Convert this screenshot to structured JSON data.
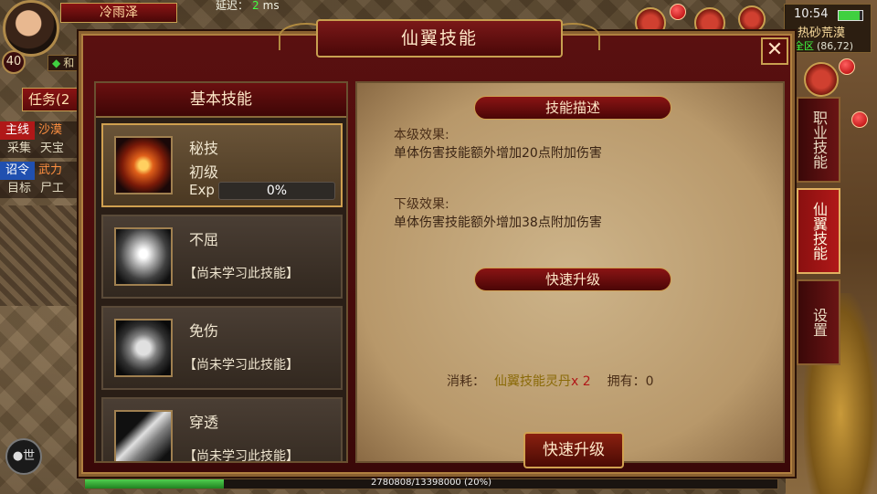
{
  "hud": {
    "player_name": "冷雨泽",
    "level": "40",
    "ping_label": "延迟：",
    "ping_value": "2",
    "ping_unit": "ms",
    "small_label": "和",
    "clock": "10:54",
    "zone_name": "热砂荒漠",
    "zone_scope": "全区",
    "zone_coords": "(86,72)",
    "battery_level": 0.9
  },
  "tasks": {
    "tab_label": "任务(2",
    "rows": [
      {
        "tag": "主线",
        "tag_color": "red",
        "text": "沙漠"
      },
      {
        "sub_a": "采集",
        "sub_b": "天宝"
      },
      {
        "tag": "诏令",
        "tag_color": "blue",
        "text": "武力"
      },
      {
        "sub_a": "目标",
        "sub_b": "尸工"
      }
    ]
  },
  "voice": {
    "label": "世"
  },
  "modal": {
    "title": "仙翼技能",
    "close": "✕",
    "left_header": "基本技能",
    "skills": [
      {
        "name": "秘技",
        "grade": "初级",
        "exp_label": "Exp",
        "exp_value": "0%",
        "icon": "fire-swirl-icon",
        "selected": true
      },
      {
        "name": "不屈",
        "status": "【尚未学习此技能】",
        "icon": "winged-figure-icon",
        "selected": false
      },
      {
        "name": "免伤",
        "status": "【尚未学习此技能】",
        "icon": "shield-icon",
        "selected": false
      },
      {
        "name": "穿透",
        "status": "【尚未学习此技能】",
        "icon": "pierce-strike-icon",
        "selected": false
      }
    ],
    "description": {
      "header": "技能描述",
      "current_label": "本级效果:",
      "current_text": "单体伤害技能额外增加20点附加伤害",
      "next_label": "下级效果:",
      "next_text": "单体伤害技能额外增加38点附加伤害"
    },
    "upgrade": {
      "header": "快速升级",
      "cost_label": "消耗：",
      "cost_item": "仙翼技能灵丹",
      "cost_qty": "x 2",
      "own_label": "拥有：",
      "own_value": "0",
      "button_label": "快速升级"
    }
  },
  "side_tabs": [
    {
      "label": "职业技能",
      "active": false
    },
    {
      "label": "仙翼技能",
      "active": true
    },
    {
      "label": "设置",
      "active": false
    }
  ],
  "exp_bar": {
    "text": "2780808/13398000 (20%)",
    "fraction": 0.2
  },
  "colors": {
    "accent_red": "#8a1414",
    "gold_border": "#c8a050",
    "active_tab": "#b01818",
    "exp_green": "#40d040"
  }
}
